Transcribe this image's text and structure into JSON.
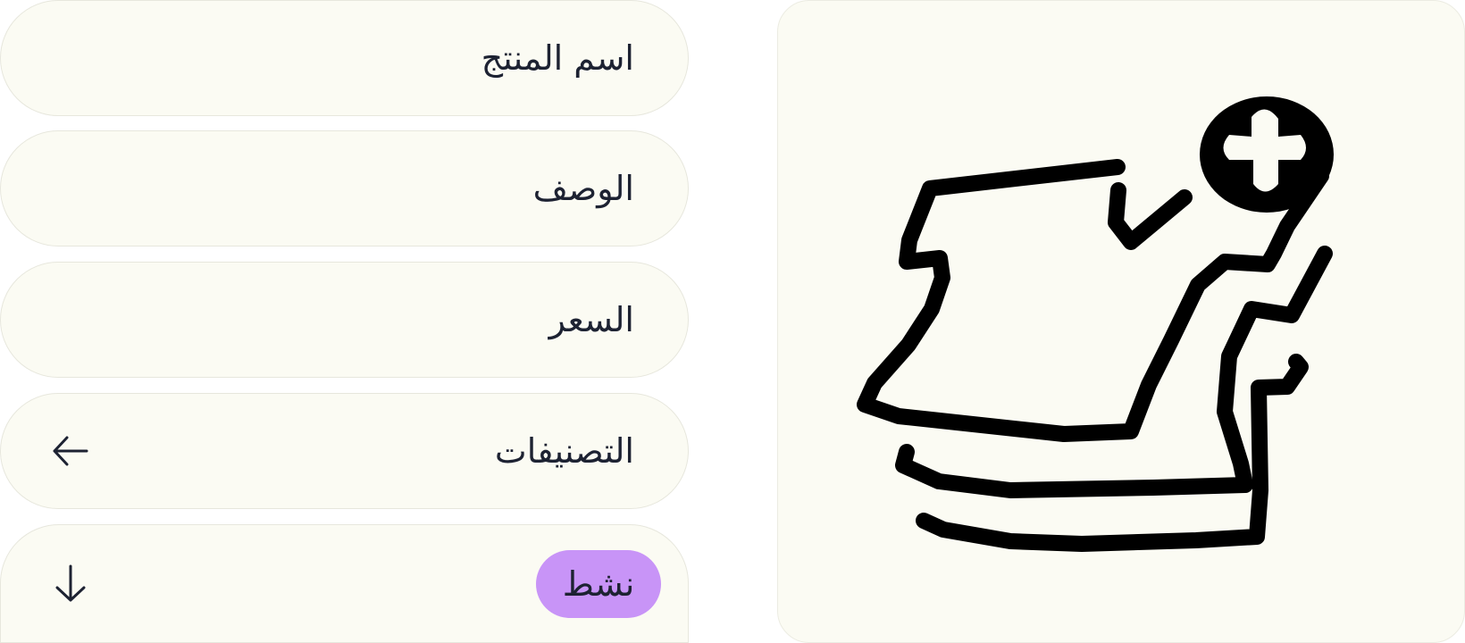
{
  "form": {
    "fields": [
      {
        "id": "name",
        "label": "اسم المنتج"
      },
      {
        "id": "description",
        "label": "الوصف"
      },
      {
        "id": "price",
        "label": "السعر"
      },
      {
        "id": "categories",
        "label": "التصنيفات",
        "icon": "arrow-left-icon"
      },
      {
        "id": "status",
        "label": "نشط",
        "icon": "arrow-down-icon"
      }
    ]
  },
  "image_card": {
    "icon": "add-product-icon"
  },
  "colors": {
    "field_background": "#fbfbf3",
    "text": "#1d2232",
    "status_active": "#c894f7"
  }
}
